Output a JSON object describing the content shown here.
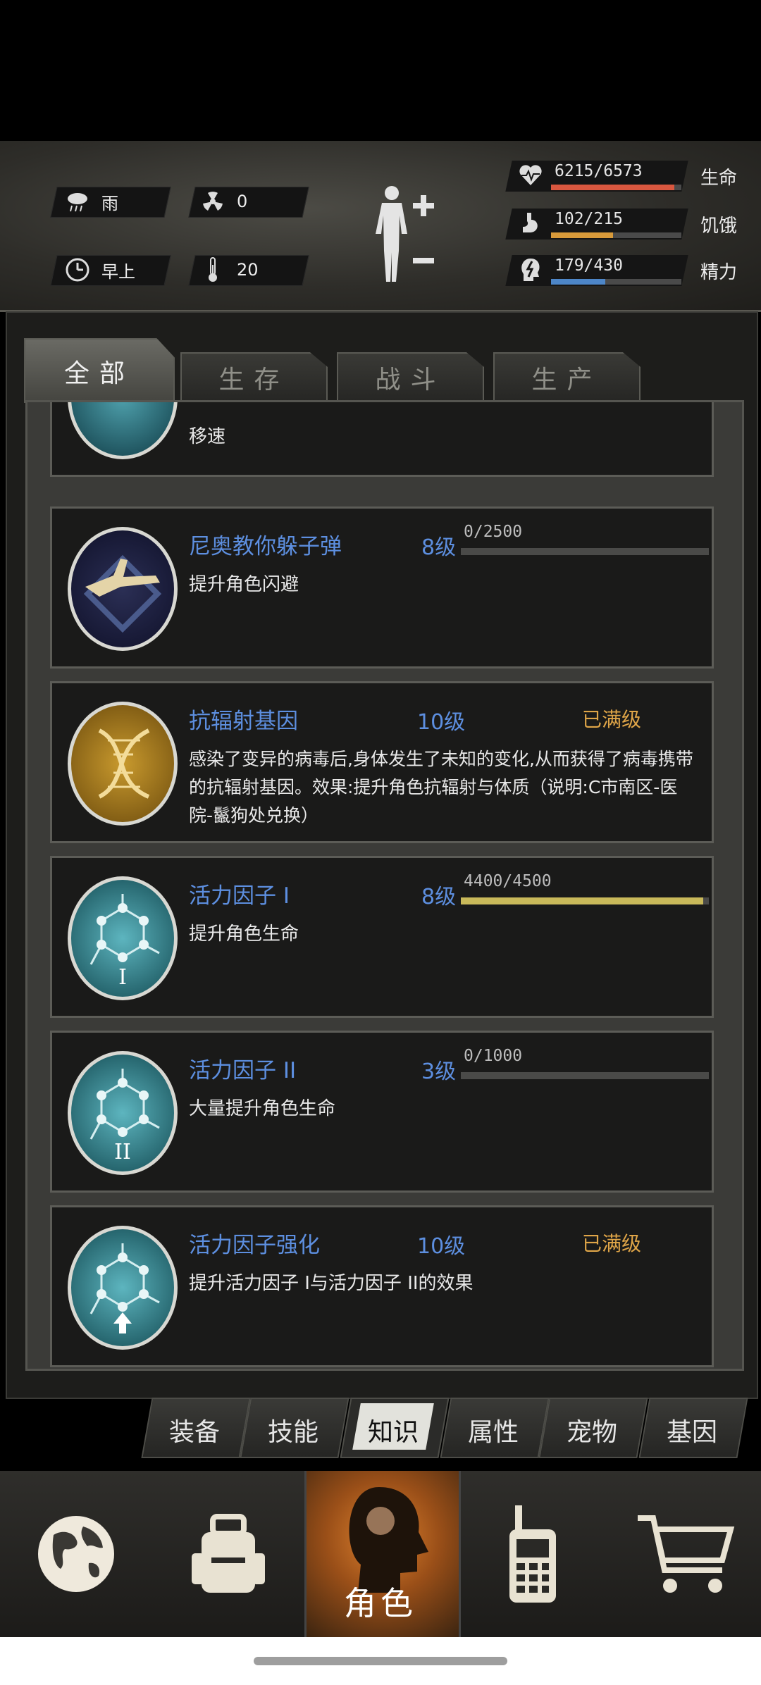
{
  "status": {
    "weather": "雨",
    "radiation": "0",
    "time_of_day": "早上",
    "temperature": "20",
    "health": {
      "value": "6215/6573",
      "label": "生命",
      "fraction": 0.946,
      "color": "#d9573f"
    },
    "hunger": {
      "value": "102/215",
      "label": "饥饿",
      "fraction": 0.474,
      "color": "#d89a3a"
    },
    "energy": {
      "value": "179/430",
      "label": "精力",
      "fraction": 0.416,
      "color": "#4d86c8"
    }
  },
  "tabs": [
    "全部",
    "生存",
    "战斗",
    "生产"
  ],
  "partial_card_text": "移速",
  "skills": [
    {
      "title": "尼奥教你躲子弹",
      "level": "8级",
      "progress": "0/2500",
      "fraction": 0,
      "desc": "提升角色闪避"
    },
    {
      "title": "抗辐射基因",
      "level": "10级",
      "maxed": "已满级",
      "desc": "感染了变异的病毒后,身体发生了未知的变化,从而获得了病毒携带的抗辐射基因。效果:提升角色抗辐射与体质（说明:C市南区-医院-鬣狗处兑换）"
    },
    {
      "title": "活力因子 I",
      "level": "8级",
      "progress": "4400/4500",
      "fraction": 0.978,
      "desc": "提升角色生命"
    },
    {
      "title": "活力因子 II",
      "level": "3级",
      "progress": "0/1000",
      "fraction": 0,
      "desc": "大量提升角色生命"
    },
    {
      "title": "活力因子强化",
      "level": "10级",
      "maxed": "已满级",
      "desc": "提升活力因子 I与活力因子 II的效果"
    }
  ],
  "sub_tabs": [
    "装备",
    "技能",
    "知识",
    "属性",
    "宠物",
    "基因"
  ],
  "bottom_nav": {
    "role_label": "角色"
  }
}
